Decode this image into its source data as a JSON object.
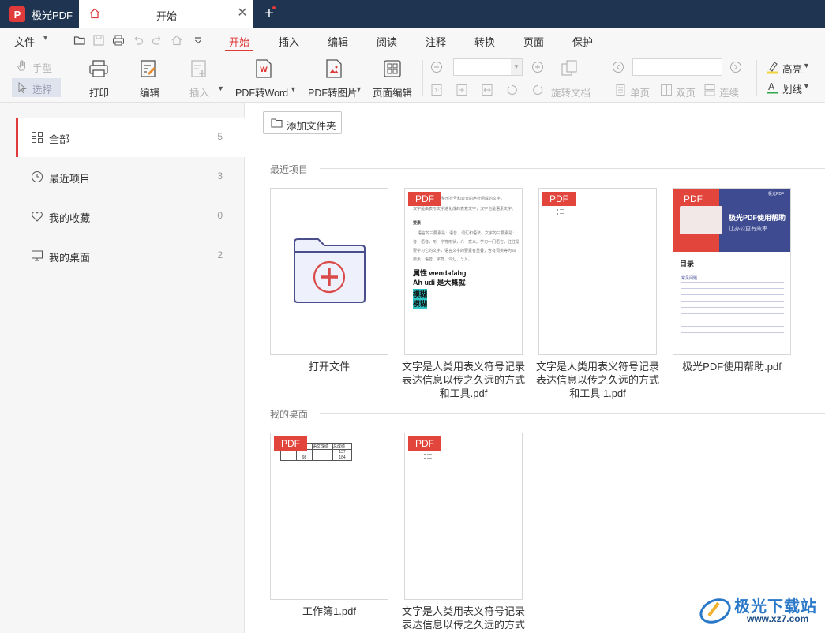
{
  "app": {
    "name": "极光PDF"
  },
  "tabs": {
    "active_tab": "开始",
    "close_glyph": "✕",
    "add_glyph": "+"
  },
  "menu": {
    "file": "文件",
    "tabs": [
      "开始",
      "插入",
      "编辑",
      "阅读",
      "注释",
      "转换",
      "页面",
      "保护"
    ],
    "active": "开始"
  },
  "toolbar": {
    "hand": "手型",
    "select": "选择",
    "print": "打印",
    "edit": "编辑",
    "insert": "插入",
    "pdf_to_word": "PDF转Word",
    "pdf_to_image": "PDF转图片",
    "page_edit": "页面编辑",
    "rotate_doc": "旋转文档",
    "single_page": "单页",
    "double_page": "双页",
    "continuous": "连续",
    "highlight": "高亮",
    "underline": "划线",
    "zoom_value": "",
    "page_value": ""
  },
  "sidebar": {
    "items": [
      {
        "label": "全部",
        "count": "5",
        "icon": "grid-icon",
        "active": true
      },
      {
        "label": "最近项目",
        "count": "3",
        "icon": "clock-icon",
        "active": false
      },
      {
        "label": "我的收藏",
        "count": "0",
        "icon": "heart-icon",
        "active": false
      },
      {
        "label": "我的桌面",
        "count": "2",
        "icon": "monitor-icon",
        "active": false
      }
    ]
  },
  "main": {
    "add_folder": "添加文件夹",
    "sections": [
      {
        "title": "最近项目",
        "cards": [
          {
            "name": "打开文件",
            "type": "open"
          },
          {
            "name": "文字是人类用表义符号记录表达信息以传之久远的方式和工具.pdf",
            "type": "pdf"
          },
          {
            "name": "文字是人类用表义符号记录表达信息以传之久远的方式和工具 1.pdf",
            "type": "pdf"
          },
          {
            "name": "极光PDF使用帮助.pdf",
            "type": "pdf"
          }
        ]
      },
      {
        "title": "我的桌面",
        "cards": [
          {
            "name": "工作簿1.pdf",
            "type": "pdf"
          },
          {
            "name": "文字是人类用表义符号记录表达信息以传之久远的方式",
            "type": "pdf"
          }
        ]
      }
    ],
    "pdf_badge": "PDF"
  },
  "thumbs": {
    "doc1": {
      "lines": [
        "义的整形符号和表音的声符组成的文字。",
        "汉字是由表形文字进化成的表意文字，汉字也是语素文字。",
        "要素",
        "语言的三要素是：语音、词汇和语法。文字的三要素是：",
        "音—语音，形—字符形状，义—意义。学习一门语言，往往是",
        "要学习它的文字，语言文字的要素有重叠，含有词类等为四",
        "要素：语音、字符、词汇、ㄅㄆ。"
      ],
      "bold1": "属性 wendafahg",
      "bold2": "Ah udi 是大概就",
      "hl1": "模糊",
      "hl2": "模糊"
    },
    "help": {
      "brand": "极光PDF",
      "banner_title": "极光PDF使用帮助",
      "banner_sub": "让办公更有效率",
      "toc": "目录",
      "toc_sub": "常见问题"
    },
    "sheet": {
      "headers": [
        "语文成绩",
        "总成绩"
      ],
      "rows": [
        [
          "",
          "",
          "137"
        ],
        [
          "",
          "98",
          "184"
        ]
      ]
    }
  },
  "watermark": {
    "text": "极光下载站",
    "url": "www.xz7.com"
  }
}
